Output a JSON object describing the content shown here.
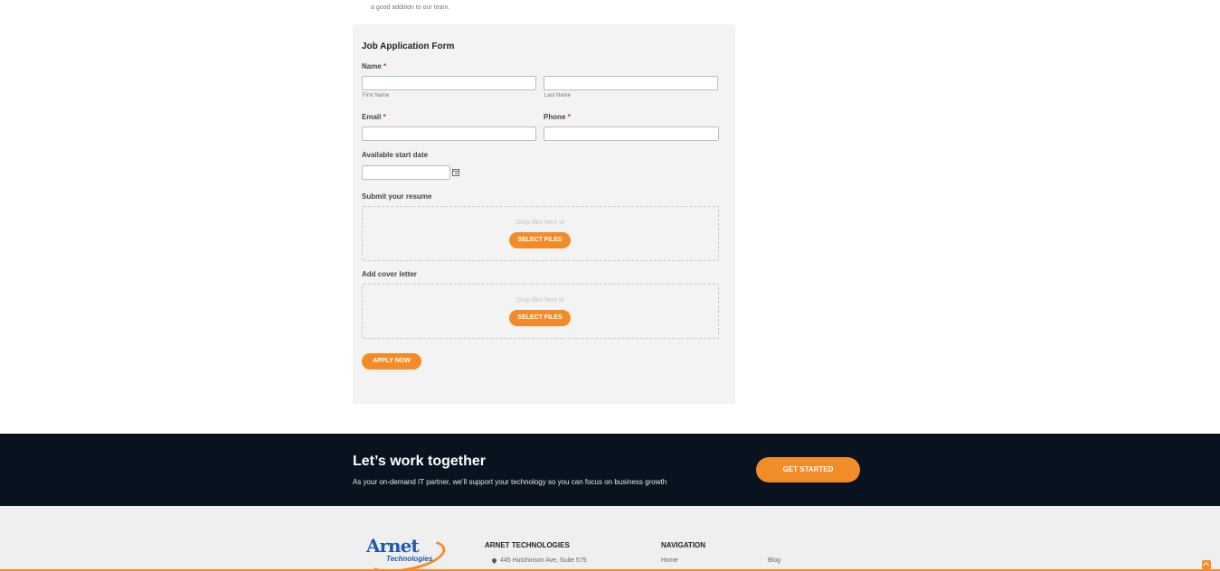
{
  "intro": {
    "line1_cut": "...",
    "line2": "a good addition to our team."
  },
  "form": {
    "title": "Job Application Form",
    "name_label": "Name",
    "required_mark": "*",
    "first_name_sublabel": "First Name",
    "last_name_sublabel": "Last Name",
    "email_label": "Email",
    "phone_label": "Phone",
    "start_date_label": "Available start date",
    "resume_label": "Submit your resume",
    "cover_letter_label": "Add cover letter",
    "drop_hint": "Drop files here or",
    "select_files_label": "SELECT FILES",
    "apply_label": "APPLY NOW",
    "accent_color": "#f28c28",
    "required_color": "#d32f2f"
  },
  "cta": {
    "title": "Let’s work together",
    "subtitle": "As your on-demand IT partner, we’ll support your technology so you can focus on business growth",
    "button_label": "GET STARTED"
  },
  "footer": {
    "logo_main": "Arnet",
    "logo_sub": "Technologies",
    "company_heading": "ARNET TECHNOLOGIES",
    "address_line": "445 Hutchinson Ave, Suite 575",
    "nav_heading": "NAVIGATION",
    "nav_items": [
      "Home",
      "Blog"
    ]
  },
  "colors": {
    "dark_band": "#08131f",
    "brand_blue": "#1f5aa8",
    "accent_orange": "#f28c28"
  },
  "icons": {
    "calendar": "calendar-icon",
    "map_pin": "map-pin-icon",
    "scroll_top": "chevron-up-icon"
  }
}
